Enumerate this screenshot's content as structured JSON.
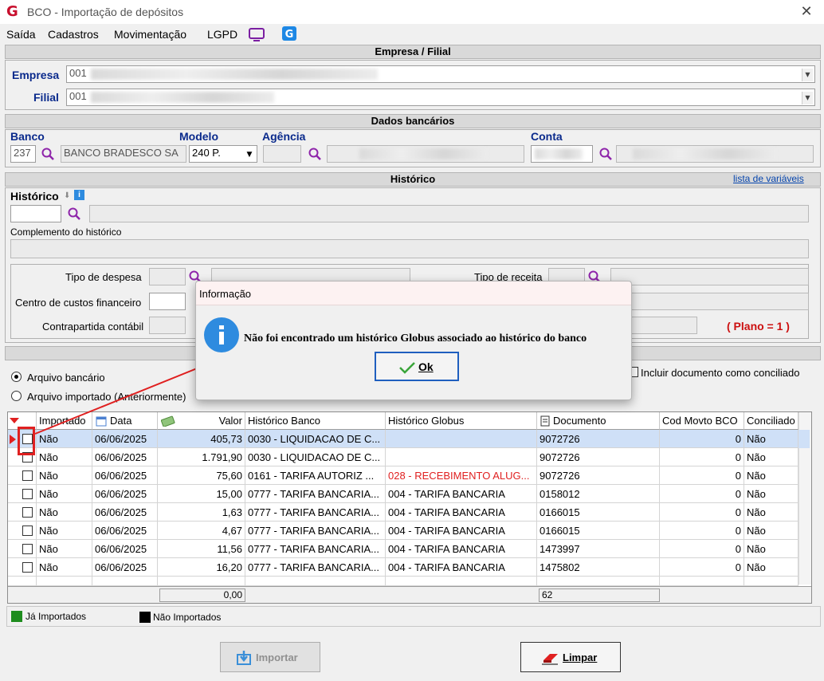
{
  "window": {
    "title": "BCO - Importação de depósitos",
    "close": "✕",
    "logo": "G"
  },
  "menu": [
    "Saída",
    "Cadastros",
    "Movimentação",
    "LGPD"
  ],
  "empresa_section": {
    "title": "Empresa / Filial",
    "empresa_label": "Empresa",
    "empresa_value": "001",
    "filial_label": "Filial",
    "filial_value": "001"
  },
  "dados_bancarios": {
    "title": "Dados bancários",
    "banco_label": "Banco",
    "banco_code": "237",
    "banco_name": "BANCO BRADESCO SA",
    "modelo_label": "Modelo",
    "modelo_value": "240 P.",
    "agencia_label": "Agência",
    "conta_label": "Conta"
  },
  "historico": {
    "title": "Histórico",
    "link": "lista de variáveis",
    "historico_label": "Histórico",
    "complemento_label": "Complemento do histórico",
    "tipo_despesa_label": "Tipo de despesa",
    "tipo_receita_label": "Tipo de receita",
    "centro_custos_label": "Centro de custos financeiro",
    "contrapartida_label": "Contrapartida contábil",
    "plano_label": "( Plano = 1 )"
  },
  "options": {
    "arquivo_bancario": "Arquivo bancário",
    "arquivo_importado": "Arquivo importado (Anteriormente)",
    "incluir_conciliado": "Incluir documento como conciliado"
  },
  "grid": {
    "headers": [
      "Importado",
      "Data",
      "Valor",
      "Histórico Banco",
      "Histórico Globus",
      "Documento",
      "Cod Movto BCO",
      "Conciliado"
    ],
    "rows": [
      {
        "importado": "Não",
        "data": "06/06/2025",
        "valor": "405,73",
        "hist_banco": "0030 - LIQUIDACAO DE C...",
        "hist_globus": "",
        "documento": "9072726",
        "cod": "0",
        "conciliado": "Não"
      },
      {
        "importado": "Não",
        "data": "06/06/2025",
        "valor": "1.791,90",
        "hist_banco": "0030 - LIQUIDACAO DE C...",
        "hist_globus": "",
        "documento": "9072726",
        "cod": "0",
        "conciliado": "Não"
      },
      {
        "importado": "Não",
        "data": "06/06/2025",
        "valor": "75,60",
        "hist_banco": "0161 - TARIFA AUTORIZ ...",
        "hist_globus": "028 - RECEBIMENTO ALUG...",
        "documento": "9072726",
        "cod": "0",
        "conciliado": "Não"
      },
      {
        "importado": "Não",
        "data": "06/06/2025",
        "valor": "15,00",
        "hist_banco": "0777 - TARIFA BANCARIA...",
        "hist_globus": "004 - TARIFA BANCARIA",
        "documento": "0158012",
        "cod": "0",
        "conciliado": "Não"
      },
      {
        "importado": "Não",
        "data": "06/06/2025",
        "valor": "1,63",
        "hist_banco": "0777 - TARIFA BANCARIA...",
        "hist_globus": "004 - TARIFA BANCARIA",
        "documento": "0166015",
        "cod": "0",
        "conciliado": "Não"
      },
      {
        "importado": "Não",
        "data": "06/06/2025",
        "valor": "4,67",
        "hist_banco": "0777 - TARIFA BANCARIA...",
        "hist_globus": "004 - TARIFA BANCARIA",
        "documento": "0166015",
        "cod": "0",
        "conciliado": "Não"
      },
      {
        "importado": "Não",
        "data": "06/06/2025",
        "valor": "11,56",
        "hist_banco": "0777 - TARIFA BANCARIA...",
        "hist_globus": "004 - TARIFA BANCARIA",
        "documento": "1473997",
        "cod": "0",
        "conciliado": "Não"
      },
      {
        "importado": "Não",
        "data": "06/06/2025",
        "valor": "16,20",
        "hist_banco": "0777 - TARIFA BANCARIA...",
        "hist_globus": "004 - TARIFA BANCARIA",
        "documento": "1475802",
        "cod": "0",
        "conciliado": "Não"
      }
    ],
    "total_valor": "0,00",
    "total_documento": "62"
  },
  "legend": {
    "importados": "Já Importados",
    "nao_importados": "Não Importados",
    "importados_color": "#1e8c1e",
    "nao_color": "#000000"
  },
  "buttons": {
    "importar": "Importar",
    "limpar": "Limpar"
  },
  "dialog": {
    "title": "Informação",
    "message": "Não foi encontrado um histórico Globus associado ao histórico do banco",
    "ok": "Ok"
  },
  "colors": {
    "accent_red": "#e02020",
    "link_blue": "#0645ad",
    "label_blue": "#0a2a8c",
    "selection": "#cfe0f7"
  }
}
